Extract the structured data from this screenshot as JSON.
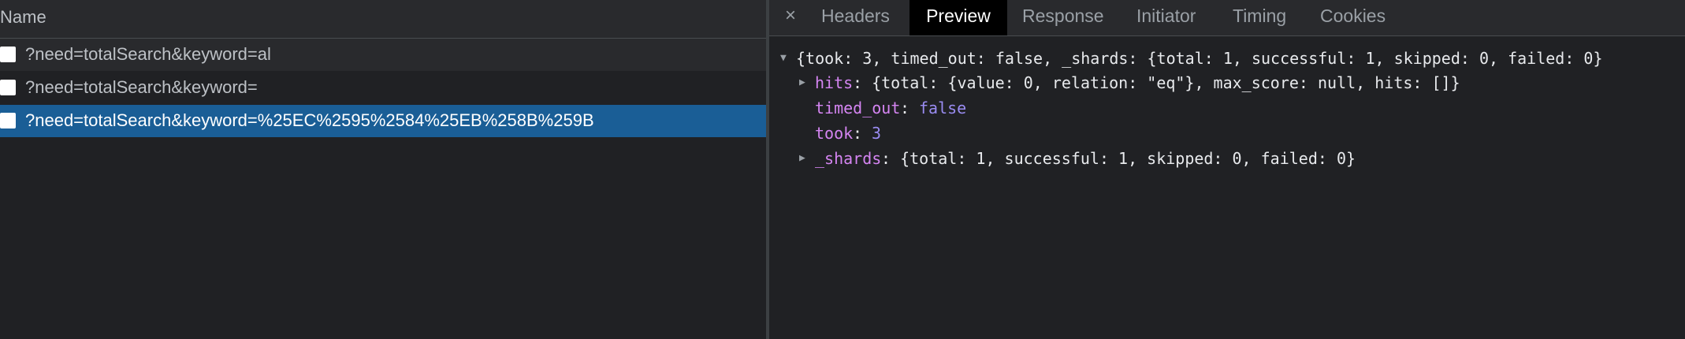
{
  "requests": {
    "header": "Name",
    "rows": [
      "?need=totalSearch&keyword=al",
      "?need=totalSearch&keyword=",
      "?need=totalSearch&keyword=%25EC%2595%2584%25EB%258B%259B"
    ],
    "selected_index": 2
  },
  "details": {
    "close_glyph": "×",
    "tabs": [
      "Headers",
      "Preview",
      "Response",
      "Initiator",
      "Timing",
      "Cookies"
    ],
    "active_tab": "Preview",
    "preview": {
      "root_summary": "{took: 3, timed_out: false, _shards: {total: 1, successful: 1, skipped: 0, failed: 0}",
      "hits_key": "hits",
      "hits_value": ": {total: {value: 0, relation: \"eq\"}, max_score: null, hits: []}",
      "timed_out_key": "timed_out",
      "timed_out_sep": ": ",
      "timed_out_value": "false",
      "took_key": "took",
      "took_sep": ": ",
      "took_value": "3",
      "shards_key": "_shards",
      "shards_value": ": {total: 1, successful: 1, skipped: 0, failed: 0}"
    }
  },
  "colors": {
    "background": "#202124",
    "selected_row": "#1a5e96",
    "key": "#d585f2",
    "keyword_value": "#9a8cf2"
  },
  "icons": {
    "close": "close-icon",
    "expand": "triangle-right-icon",
    "collapse": "triangle-down-icon"
  }
}
